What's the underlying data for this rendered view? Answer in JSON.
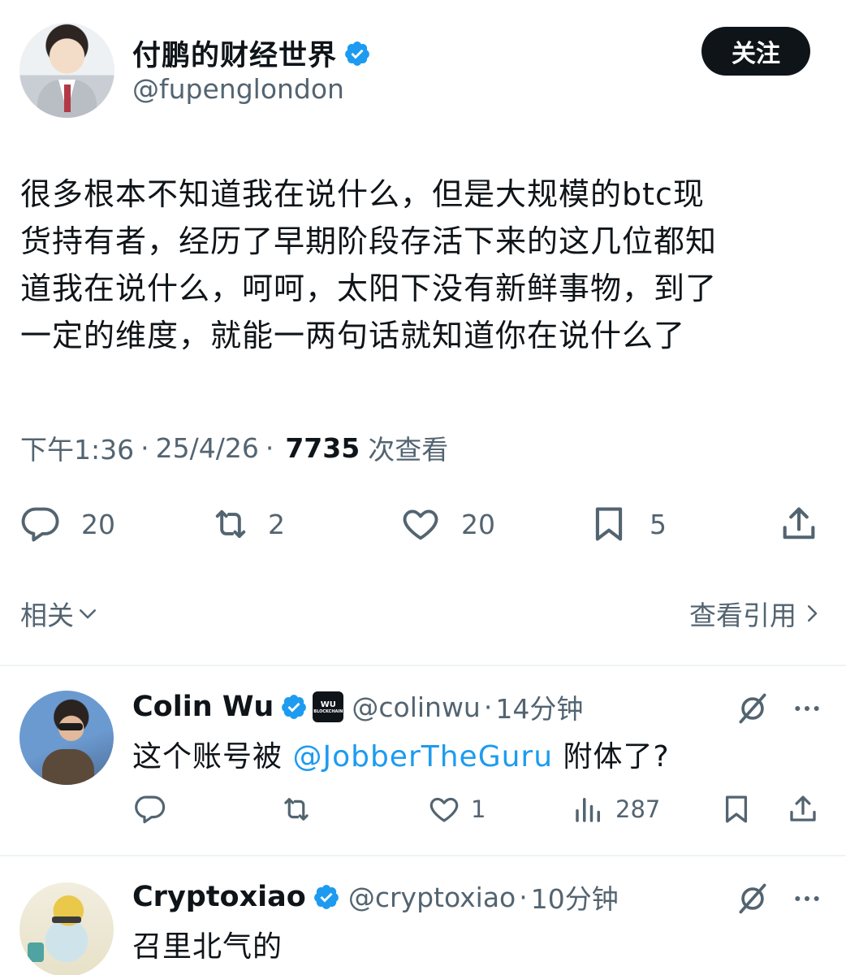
{
  "author": {
    "display_name": "付鹏的财经世界",
    "handle": "@fupenglondon",
    "follow_label": "关注"
  },
  "tweet": {
    "lines": [
      "很多根本不知道我在说什么，但是大规模的btc现",
      "货持有者，经历了早期阶段存活下来的这几位都知",
      "道我在说什么，呵呵，太阳下没有新鲜事物，到了",
      "一定的维度，就能一两句话就知道你在说什么了"
    ],
    "time": "下午1:36",
    "date": "25/4/26",
    "separator": "·",
    "views": "7735",
    "views_label": "次查看"
  },
  "actions": {
    "replies": "20",
    "retweets": "2",
    "likes": "20",
    "bookmarks": "5"
  },
  "related": {
    "label": "相关",
    "quotes_label": "查看引用"
  },
  "replies": [
    {
      "name": "Colin Wu",
      "badge_line1": "WU",
      "badge_line2": "BLOCKCHAIN",
      "handle": "@colinwu",
      "time": "14分钟",
      "text_before": "这个账号被 ",
      "mention": "@JobberTheGuru",
      "text_after": " 附体了?",
      "likes": "1",
      "views": "287"
    },
    {
      "name": "Cryptoxiao",
      "handle": "@cryptoxiao",
      "time": "10分钟",
      "text": "召里北气的"
    }
  ],
  "colors": {
    "text": "#0f1419",
    "secondary": "#536471",
    "accent": "#1d9bf0",
    "divider": "#eff3f4"
  }
}
